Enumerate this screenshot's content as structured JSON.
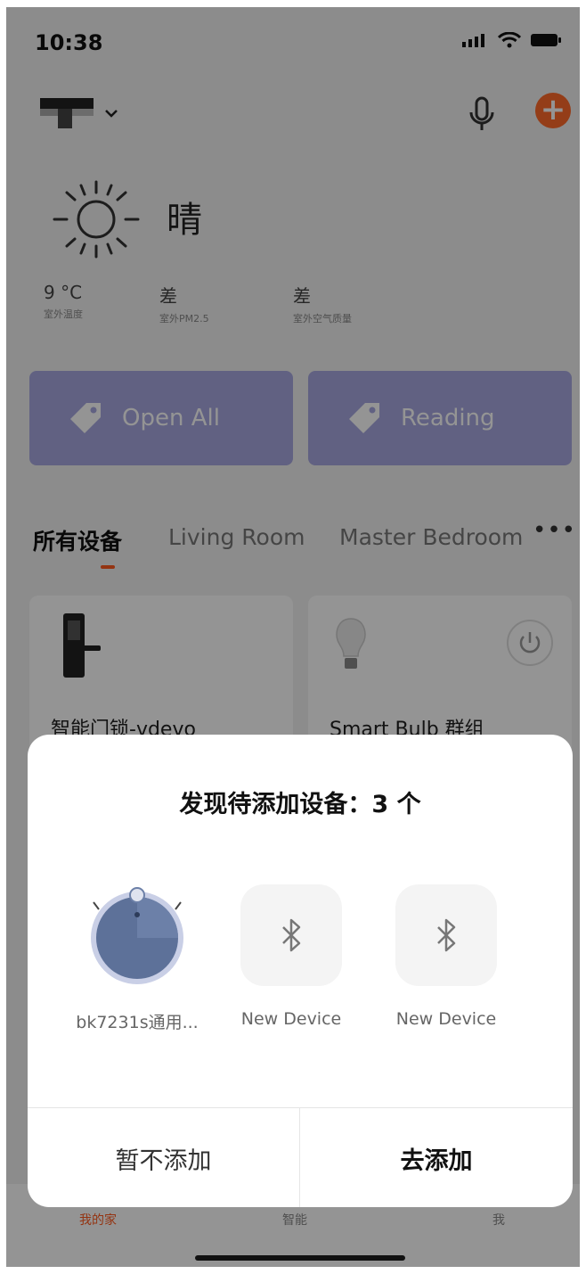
{
  "status_bar": {
    "time": "10:38"
  },
  "header": {
    "add_icon": "plus-icon"
  },
  "weather": {
    "condition": "晴",
    "stats": [
      {
        "value": "9 °C",
        "label": "室外温度"
      },
      {
        "value": "差",
        "label": "室外PM2.5"
      },
      {
        "value": "差",
        "label": "室外空气质量"
      }
    ]
  },
  "scenes": [
    {
      "name": "Open All"
    },
    {
      "name": "Reading"
    }
  ],
  "tabs": [
    {
      "label": "所有设备"
    },
    {
      "label": "Living Room"
    },
    {
      "label": "Master Bedroom"
    }
  ],
  "devices": [
    {
      "name": "智能门锁-vdevo"
    },
    {
      "name": "Smart Bulb 群组"
    }
  ],
  "tabbar": {
    "items": [
      {
        "label": "我的家"
      },
      {
        "label": "智能"
      },
      {
        "label": "我"
      }
    ]
  },
  "modal": {
    "title": "发现待添加设备：3 个",
    "devices": [
      {
        "label": "bk7231s通用...",
        "icon": "robot-vacuum-icon"
      },
      {
        "label": "New Device",
        "icon": "bluetooth-icon"
      },
      {
        "label": "New Device",
        "icon": "bluetooth-icon"
      }
    ],
    "cancel_label": "暂不添加",
    "confirm_label": "去添加"
  },
  "colors": {
    "accent": "#ff5a1f",
    "scene_card": "#a7a8e0",
    "overlay": "rgba(0,0,0,0.42)"
  }
}
